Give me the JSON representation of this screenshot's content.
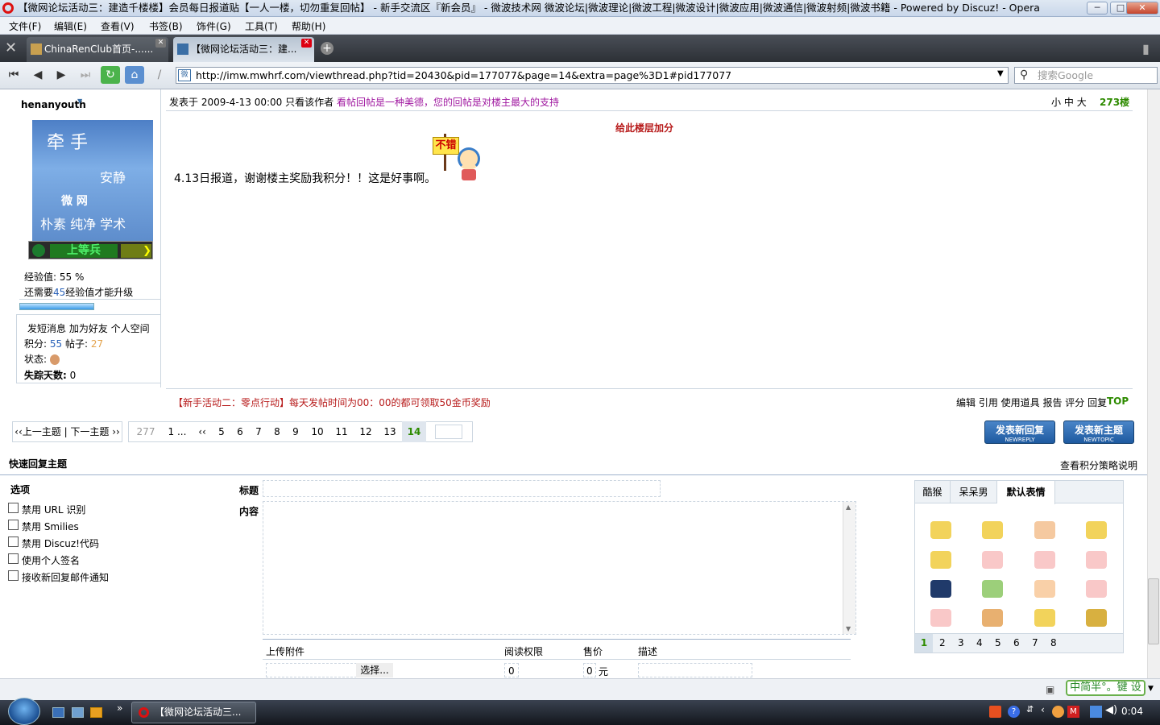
{
  "window": {
    "title": "【微网论坛活动三：建造千楼楼】会员每日报道贴【一人一楼，切勿重复回帖】 - 新手交流区『新会员』 - 微波技术网 微波论坛|微波理论|微波工程|微波设计|微波应用|微波通信|微波射频|微波书籍 - Powered by Discuz! - Opera",
    "min_label": "─",
    "max_label": "□",
    "close_label": "✕"
  },
  "menu": [
    "文件(F)",
    "编辑(E)",
    "查看(V)",
    "书签(B)",
    "饰件(G)",
    "工具(T)",
    "帮助(H)"
  ],
  "tabs": [
    {
      "label": "ChinaRenClub首页-......",
      "active": false
    },
    {
      "label": "【微网论坛活动三：建...",
      "active": true
    }
  ],
  "address": {
    "url": "http://imw.mwhrf.com/viewthread.php?tid=20430&pid=177077&page=14&extra=page%3D1#pid177077",
    "site_icon": "微",
    "search_placeholder": "搜索Google"
  },
  "post": {
    "author": "henanyouth",
    "avatar_text_top": "牵 手",
    "avatar_text_mid": "安静",
    "avatar_text_mid2": "微   网",
    "avatar_text_bottom": "朴素 纯净 学术",
    "rank_title": "上等兵",
    "exp_label": "经验值: 55 %",
    "exp_need_prefix": "还需要",
    "exp_need_value": "45",
    "exp_need_suffix": "经验值才能升级",
    "exp_progress": 0.55,
    "actions_line": "发短消息 加为好友 个人空间",
    "points_label": "积分: ",
    "points_value": "55",
    "posts_label": " 帖子: ",
    "posts_value": "27",
    "status_label": "状态:",
    "missing_label": "失踪天数:",
    "missing_value": "0",
    "posted_at": "发表于 2009-4-13 00:00",
    "only_author": "只看该作者",
    "slogan": "看帖回帖是一种美德，您的回帖是对楼主最大的支持",
    "font_small": "小",
    "font_mid": "中",
    "font_large": "大",
    "floor": "273楼",
    "rate_link": "给此楼层加分",
    "sticker_text": "不错",
    "body": "4.13日报道，谢谢楼主奖励我积分！！这是好事啊。",
    "footer_notice": "【新手活动二：零点行动】每天发帖时间为00：00的都可领取50金币奖励",
    "footer_actions": "编辑 引用 使用道具 报告 评分 回复",
    "top_link": "TOP"
  },
  "pagination": {
    "prev_next": "‹‹上一主题 | 下一主题 ››",
    "total": "277",
    "first": "1 ...",
    "prev": "‹‹",
    "pages": [
      "5",
      "6",
      "7",
      "8",
      "9",
      "10",
      "11",
      "12",
      "13"
    ],
    "current": "14",
    "btn_new_reply": "发表新回复",
    "btn_new_reply_sub": "NEWREPLY",
    "btn_new_topic": "发表新主题",
    "btn_new_topic_sub": "NEWTOPIC"
  },
  "quick_reply": {
    "heading": "快速回复主题",
    "policy_link": "查看积分策略说明",
    "options_heading": "选项",
    "options": [
      "禁用 URL 识别",
      "禁用 Smilies",
      "禁用 Discuz!代码",
      "使用个人签名",
      "接收新回复邮件通知"
    ],
    "title_label": "标题",
    "content_label": "内容",
    "attach_header": [
      "上传附件",
      "阅读权限",
      "售价",
      "描述"
    ],
    "choose_btn": "选择...",
    "read_perm_value": "0",
    "price_value": "0",
    "price_unit": "元",
    "emoji_tabs": [
      "酷猴",
      "呆呆男",
      "默认表情"
    ],
    "emoji_pages": [
      "1",
      "2",
      "3",
      "4",
      "5",
      "6",
      "7",
      "8"
    ]
  },
  "statusbar": {
    "ime": "中简半°。键 设"
  },
  "taskbar": {
    "item": "【微网论坛活动三...",
    "clock": "0:04"
  },
  "colors": {
    "accent_green": "#2e8b00",
    "link_blue": "#2a62b9",
    "slogan_purple": "#a019a0",
    "notice_red": "#b71a1a"
  }
}
